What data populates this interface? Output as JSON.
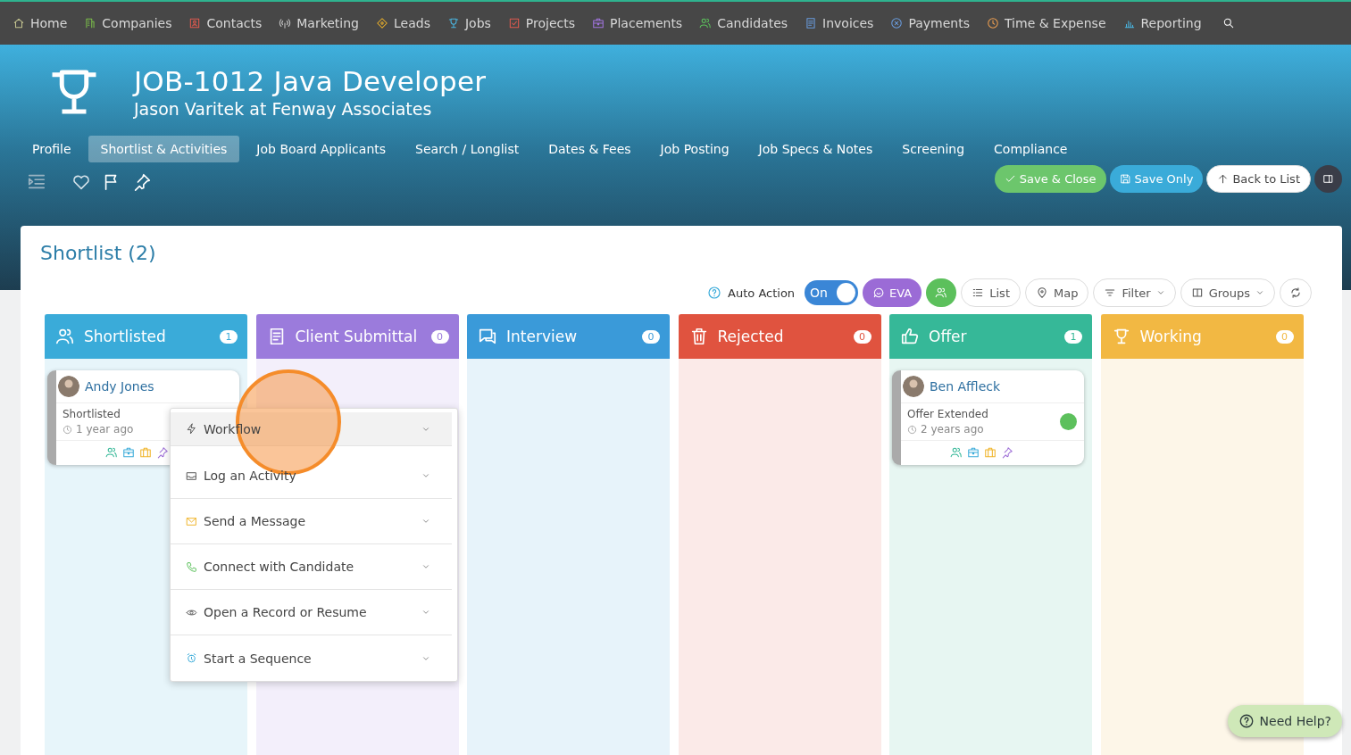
{
  "nav": [
    {
      "label": "Home",
      "kind": "home"
    },
    {
      "label": "Companies",
      "kind": "building"
    },
    {
      "label": "Contacts",
      "kind": "contact"
    },
    {
      "label": "Marketing",
      "kind": "signal"
    },
    {
      "label": "Leads",
      "kind": "target"
    },
    {
      "label": "Jobs",
      "kind": "trophy"
    },
    {
      "label": "Projects",
      "kind": "check-square"
    },
    {
      "label": "Placements",
      "kind": "briefcase"
    },
    {
      "label": "Candidates",
      "kind": "people"
    },
    {
      "label": "Invoices",
      "kind": "doc"
    },
    {
      "label": "Payments",
      "kind": "coin"
    },
    {
      "label": "Time & Expense",
      "kind": "clock"
    },
    {
      "label": "Reporting",
      "kind": "chart"
    }
  ],
  "header": {
    "title": "JOB-1012 Java Developer",
    "subtitle": "Jason Varitek at Fenway Associates"
  },
  "tabs": [
    {
      "label": "Profile",
      "selected": false
    },
    {
      "label": "Shortlist & Activities",
      "selected": true
    },
    {
      "label": "Job Board Applicants",
      "selected": false
    },
    {
      "label": "Search / Longlist",
      "selected": false
    },
    {
      "label": "Dates & Fees",
      "selected": false
    },
    {
      "label": "Job Posting",
      "selected": false
    },
    {
      "label": "Job Specs & Notes",
      "selected": false
    },
    {
      "label": "Screening",
      "selected": false
    },
    {
      "label": "Compliance",
      "selected": false
    }
  ],
  "actions": [
    {
      "label": "Save & Close",
      "kind": "save-close"
    },
    {
      "label": "Save Only",
      "kind": "save"
    },
    {
      "label": "Back to List",
      "kind": "back"
    },
    {
      "kind": "panel"
    }
  ],
  "shortlist": {
    "title": "Shortlist (2)"
  },
  "toolbar": {
    "auto_action": {
      "label": "Auto Action",
      "state": "On",
      "on": true
    },
    "buttons": [
      {
        "kind": "eva",
        "label": "EVA"
      },
      {
        "kind": "people"
      },
      {
        "kind": "list",
        "label": "List"
      },
      {
        "kind": "map",
        "label": "Map"
      },
      {
        "kind": "filter",
        "label": "Filter"
      },
      {
        "kind": "groups",
        "label": "Groups"
      },
      {
        "kind": "refresh"
      }
    ]
  },
  "columns": [
    {
      "label": "Shortlisted",
      "count": "1",
      "kind": "people",
      "color": "#3aabd9",
      "cards": [
        {
          "name": "Andy Jones",
          "status": "Shortlisted",
          "time": "1 year ago"
        }
      ]
    },
    {
      "label": "Client Submittal",
      "count": "0",
      "kind": "doc",
      "color": "#9b7bdc"
    },
    {
      "label": "Interview",
      "count": "0",
      "kind": "chat",
      "color": "#3a9ad9"
    },
    {
      "label": "Rejected",
      "count": "0",
      "kind": "trash",
      "color": "#e0533f"
    },
    {
      "label": "Offer",
      "count": "1",
      "kind": "thumb",
      "color": "#36b898",
      "cards": [
        {
          "name": "Ben Affleck",
          "status": "Offer Extended",
          "time": "2 years ago",
          "color": "#5cc05c"
        }
      ]
    },
    {
      "label": "Working",
      "count": "0",
      "kind": "trophy",
      "color": "#f2b843"
    }
  ],
  "menu": [
    {
      "label": "Workflow",
      "kind": "bolt",
      "selected": true
    },
    {
      "label": "Log an Activity",
      "kind": "inbox",
      "selected": false
    },
    {
      "label": "Send a Message",
      "kind": "mail",
      "selected": false
    },
    {
      "label": "Connect with Candidate",
      "kind": "phone",
      "selected": false
    },
    {
      "label": "Open a Record or Resume",
      "kind": "eye",
      "selected": false
    },
    {
      "label": "Start a Sequence",
      "kind": "alarm",
      "selected": false
    }
  ],
  "help": {
    "label": "Need Help?"
  }
}
